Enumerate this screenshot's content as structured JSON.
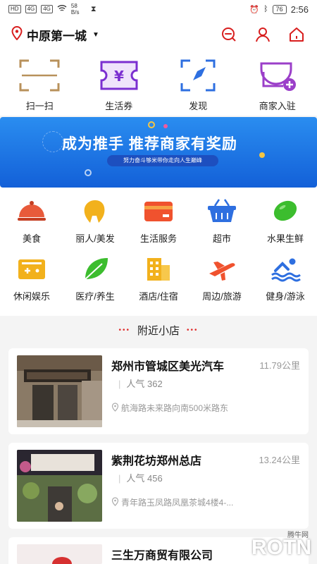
{
  "status": {
    "left_badges": [
      "HD",
      "4G",
      "4G"
    ],
    "speed": "58 B/s",
    "battery": "76",
    "time": "2:56"
  },
  "header": {
    "city": "中原第一城"
  },
  "quick_actions": [
    {
      "label": "扫一扫",
      "icon": "scan-icon"
    },
    {
      "label": "生活券",
      "icon": "ticket-icon"
    },
    {
      "label": "发现",
      "icon": "compass-icon"
    },
    {
      "label": "商家入驻",
      "icon": "store-add-icon"
    }
  ],
  "banner": {
    "title": "成为推手 推荐商家有奖励",
    "subtitle": "努力奋斗够米带你走向人生巅峰"
  },
  "categories": [
    {
      "label": "美食",
      "icon": "food-cloche-icon",
      "color": "#e85a3a"
    },
    {
      "label": "丽人/美发",
      "icon": "hair-icon",
      "color": "#f2b11c"
    },
    {
      "label": "生活服务",
      "icon": "card-icon",
      "color": "#f0522e"
    },
    {
      "label": "超市",
      "icon": "basket-icon",
      "color": "#2e6fe0"
    },
    {
      "label": "水果生鲜",
      "icon": "lime-icon",
      "color": "#3cbd2e"
    },
    {
      "label": "休闲娱乐",
      "icon": "gamepad-icon",
      "color": "#f2b11c"
    },
    {
      "label": "医疗/养生",
      "icon": "leaf-icon",
      "color": "#3cbd2e"
    },
    {
      "label": "酒店/住宿",
      "icon": "hotel-icon",
      "color": "#f2b11c"
    },
    {
      "label": "周边/旅游",
      "icon": "plane-icon",
      "color": "#f0522e"
    },
    {
      "label": "健身/游泳",
      "icon": "swim-icon",
      "color": "#2e6fe0"
    }
  ],
  "nearby": {
    "title": "附近小店",
    "shops": [
      {
        "name": "郑州市管城区美光汽车",
        "distance": "11.79公里",
        "popularity": "人气 362",
        "address": "航海路未来路向南500米路东"
      },
      {
        "name": "紫荆花坊郑州总店",
        "distance": "13.24公里",
        "popularity": "人气 456",
        "address": "青年路玉凤路凤凰茶城4楼4-..."
      },
      {
        "name": "三生万商贸有限公司",
        "distance": "",
        "popularity": "",
        "address": ""
      }
    ]
  },
  "watermark": {
    "text": "ROTN",
    "small": "腾牛网"
  }
}
